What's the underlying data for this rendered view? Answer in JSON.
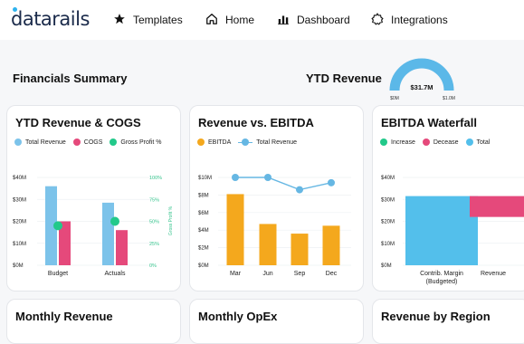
{
  "header": {
    "logo": "datarails",
    "nav": [
      {
        "label": "Templates",
        "icon": "star-icon"
      },
      {
        "label": "Home",
        "icon": "home-icon"
      },
      {
        "label": "Dashboard",
        "icon": "bar-chart-icon"
      },
      {
        "label": "Integrations",
        "icon": "gear-icon"
      }
    ]
  },
  "section": {
    "title": "Financials Summary",
    "ytd_title": "YTD Revenue",
    "gauge": {
      "value_label": "$31.7M",
      "min_label": "$0M",
      "max_label": "$1.0M",
      "fill_fraction": 1.0,
      "color": "#5bb8e8"
    }
  },
  "cards": {
    "c1": {
      "title": "YTD Revenue & COGS",
      "legend": [
        "Total Revenue",
        "COGS",
        "Gross Profit %"
      ]
    },
    "c2": {
      "title": "Revenue vs. EBITDA",
      "legend": [
        "EBITDA",
        "Total Revenue"
      ]
    },
    "c3": {
      "title": "EBITDA Waterfall",
      "legend": [
        "Increase",
        "Decease",
        "Total"
      ]
    },
    "c4": {
      "title": "Monthly Revenue"
    },
    "c5": {
      "title": "Monthly OpEx"
    },
    "c6": {
      "title": "Revenue by Region"
    }
  },
  "colors": {
    "blue": "#7cc3ea",
    "pink": "#e5497b",
    "green": "#22c98a",
    "orange": "#f4a81d",
    "line": "#66b7e3",
    "total": "#53bfeb"
  },
  "chart_data": [
    {
      "type": "bar",
      "categories": [
        "Budget",
        "Actuals"
      ],
      "series": [
        {
          "name": "Total Revenue",
          "values": [
            36,
            28.5
          ]
        },
        {
          "name": "COGS",
          "values": [
            20,
            16
          ]
        },
        {
          "name": "Gross Profit %",
          "values": [
            45,
            50
          ]
        }
      ],
      "y_ticks": [
        "$0M",
        "$10M",
        "$20M",
        "$30M",
        "$40M"
      ],
      "y2_ticks": [
        "0%",
        "25%",
        "50%",
        "75%",
        "100%"
      ],
      "y2label": "Gross Profit %",
      "ylim": [
        0,
        40
      ],
      "y2lim": [
        0,
        100
      ]
    },
    {
      "type": "bar",
      "categories": [
        "Mar",
        "Jun",
        "Sep",
        "Dec"
      ],
      "series": [
        {
          "name": "EBITDA",
          "values": [
            8.1,
            4.7,
            3.6,
            4.5
          ]
        },
        {
          "name": "Total Revenue",
          "values": [
            10,
            10,
            8.6,
            9.4
          ]
        }
      ],
      "y_ticks": [
        "$0M",
        "$2M",
        "$4M",
        "$6M",
        "$8M",
        "$10M"
      ],
      "ylim": [
        0,
        12
      ]
    },
    {
      "type": "bar",
      "categories": [
        "Contrib. Margin (Budgeted)",
        "Revenue"
      ],
      "category_lines": [
        [
          "Contrib. Margin",
          "(Budgeted)"
        ],
        [
          "Revenue"
        ]
      ],
      "bars": [
        {
          "category": "Contrib. Margin (Budgeted)",
          "kind": "Total",
          "from": 0,
          "to": 31.5
        },
        {
          "category": "Revenue",
          "kind": "Decease",
          "from": 31.5,
          "to": 22
        }
      ],
      "y_ticks": [
        "$0M",
        "$10M",
        "$20M",
        "$30M",
        "$40M"
      ],
      "ylim": [
        0,
        40
      ]
    }
  ]
}
